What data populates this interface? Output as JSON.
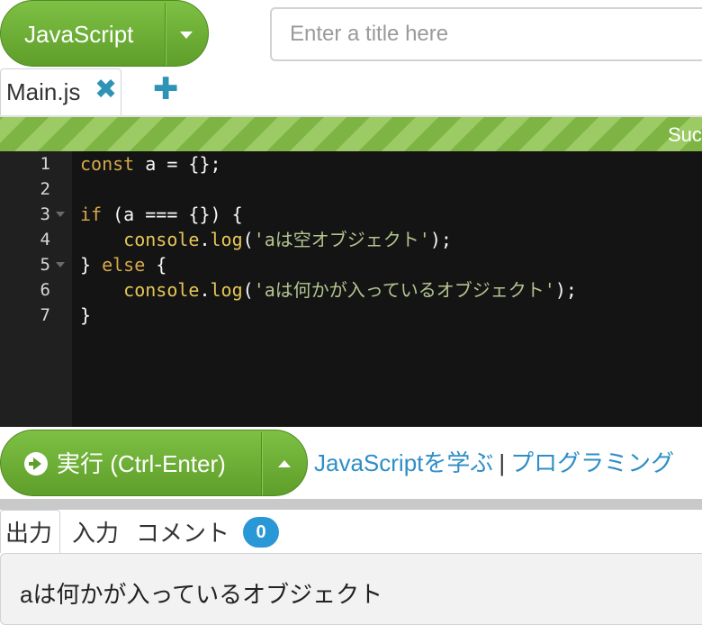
{
  "header": {
    "language_label": "JavaScript",
    "title_placeholder": "Enter a title here"
  },
  "tabs": [
    {
      "label": "Main.js"
    }
  ],
  "status": {
    "text": "Suc"
  },
  "editor": {
    "line_numbers": [
      "1",
      "2",
      "3",
      "4",
      "5",
      "6",
      "7"
    ],
    "lines": [
      [
        {
          "t": "kw",
          "v": "const"
        },
        {
          "t": "pl",
          "v": " a = {};"
        }
      ],
      [],
      [
        {
          "t": "kw",
          "v": "if"
        },
        {
          "t": "pl",
          "v": " (a === {}) {"
        }
      ],
      [
        {
          "t": "pl",
          "v": "    "
        },
        {
          "t": "fn",
          "v": "console"
        },
        {
          "t": "pl",
          "v": "."
        },
        {
          "t": "fn",
          "v": "log"
        },
        {
          "t": "pl",
          "v": "("
        },
        {
          "t": "str",
          "v": "'aは空オブジェクト'"
        },
        {
          "t": "pl",
          "v": ");"
        }
      ],
      [
        {
          "t": "pl",
          "v": "} "
        },
        {
          "t": "kw",
          "v": "else"
        },
        {
          "t": "pl",
          "v": " {"
        }
      ],
      [
        {
          "t": "pl",
          "v": "    "
        },
        {
          "t": "fn",
          "v": "console"
        },
        {
          "t": "pl",
          "v": "."
        },
        {
          "t": "fn",
          "v": "log"
        },
        {
          "t": "pl",
          "v": "("
        },
        {
          "t": "str",
          "v": "'aは何かが入っているオブジェクト'"
        },
        {
          "t": "pl",
          "v": ");"
        }
      ],
      [
        {
          "t": "pl",
          "v": "}"
        }
      ]
    ]
  },
  "run": {
    "label": "実行 (Ctrl-Enter)",
    "link_learn": "JavaScriptを学ぶ",
    "separator": "|",
    "link_programming": "プログラミング"
  },
  "output_tabs": {
    "output": "出力",
    "input": "入力",
    "comments": "コメント",
    "comment_count": "0"
  },
  "output": {
    "text": "aは何かが入っているオブジェクト"
  },
  "colors": {
    "accent_green": "#6aaa34",
    "link_blue": "#2e8ec6",
    "icon_blue": "#2e93b5",
    "editor_bg": "#141414"
  }
}
